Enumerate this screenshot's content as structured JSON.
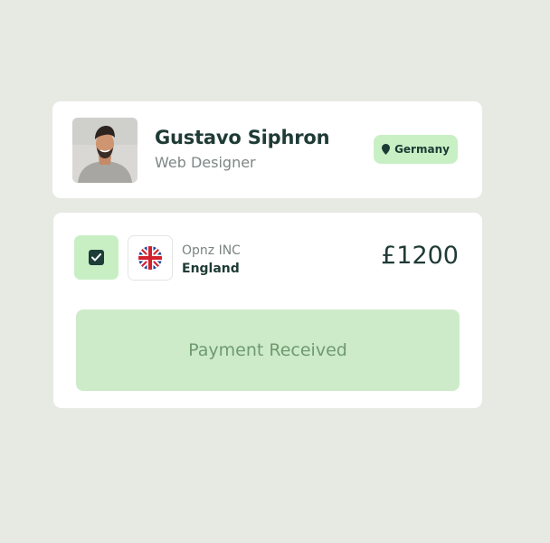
{
  "profile": {
    "name": "Gustavo Siphron",
    "role": "Web Designer",
    "location": "Germany",
    "location_icon": "map-pin-icon",
    "avatar_icon": "avatar"
  },
  "payment": {
    "checked": true,
    "check_icon": "checkmark-icon",
    "flag_icon": "uk-flag-icon",
    "company": "Opnz INC",
    "country": "England",
    "amount": "£1200",
    "status": "Payment Received"
  },
  "colors": {
    "background": "#e7e9e3",
    "card": "#ffffff",
    "dark_green": "#1f3b36",
    "badge_green": "#c8f0c4",
    "status_green": "#cdebc9",
    "status_text": "#6f9a6f",
    "muted_text": "#7d8785"
  }
}
